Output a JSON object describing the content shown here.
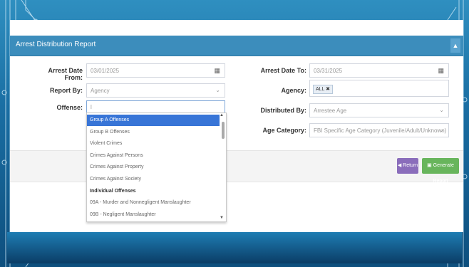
{
  "header": {
    "title": "Arrest Distribution Report",
    "collapse_icon": "chevron-up-icon"
  },
  "form": {
    "arrest_date_from": {
      "label": "Arrest Date From:",
      "value": "03/01/2025"
    },
    "arrest_date_to": {
      "label": "Arrest Date To:",
      "value": "03/31/2025"
    },
    "report_by": {
      "label": "Report By:",
      "value": "Agency"
    },
    "agency": {
      "label": "Agency:",
      "tag": "ALL ✖"
    },
    "offense": {
      "label": "Offense:",
      "value": "l"
    },
    "distributed_by": {
      "label": "Distributed By:",
      "value": "Arrestee Age"
    },
    "age_category": {
      "label": "Age Category:",
      "value": "FBI Specific Age Category (Juvenile/Adult/Unknown)"
    }
  },
  "offense_options": [
    {
      "label": "Group A Offenses",
      "selected": true,
      "group": false
    },
    {
      "label": "Group B Offenses",
      "selected": false,
      "group": false
    },
    {
      "label": "Violent Crimes",
      "selected": false,
      "group": false
    },
    {
      "label": "Crimes Against Persons",
      "selected": false,
      "group": false
    },
    {
      "label": "Crimes Against Property",
      "selected": false,
      "group": false
    },
    {
      "label": "Crimes Against Society",
      "selected": false,
      "group": false
    },
    {
      "label": "Individual Offenses",
      "selected": false,
      "group": true
    },
    {
      "label": "09A - Murder and Nonnegligent Manslaughter",
      "selected": false,
      "group": false
    },
    {
      "label": "09B - Negligent Manslaughter",
      "selected": false,
      "group": false
    }
  ],
  "buttons": {
    "return_label": "◀ Return",
    "generate_label": "▣ Generate Report"
  },
  "colors": {
    "header": "#3c8dbc",
    "selected_option": "#3875d7",
    "return_button": "#8a6dbb",
    "generate_button": "#68b55c"
  }
}
